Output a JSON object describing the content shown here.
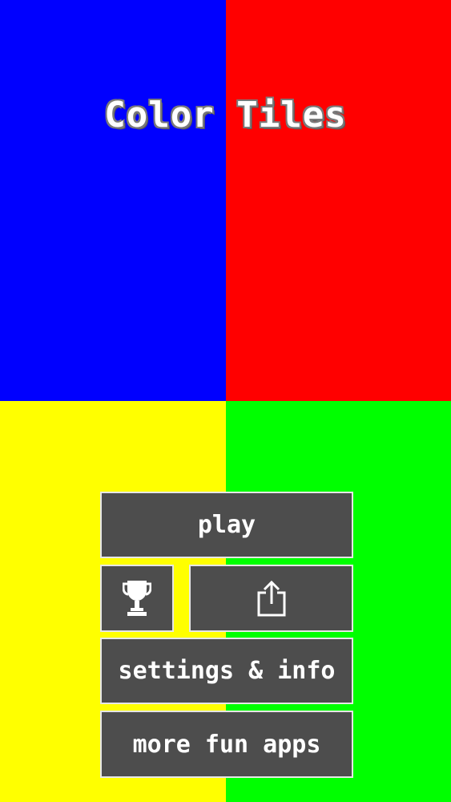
{
  "app": {
    "title": "Color Tiles"
  },
  "tiles": {
    "top_left_color": "#0000ff",
    "top_right_color": "#ff0000",
    "bottom_left_color": "#ffff00",
    "bottom_right_color": "#00ff00"
  },
  "menu": {
    "play_label": "play",
    "settings_label": "settings & info",
    "more_label": "more fun apps",
    "trophy_icon": "trophy-icon",
    "share_icon": "share-icon"
  },
  "theme": {
    "button_bg": "#4d4d4d",
    "button_border": "#e6e6e6",
    "text_color": "#ffffff"
  }
}
